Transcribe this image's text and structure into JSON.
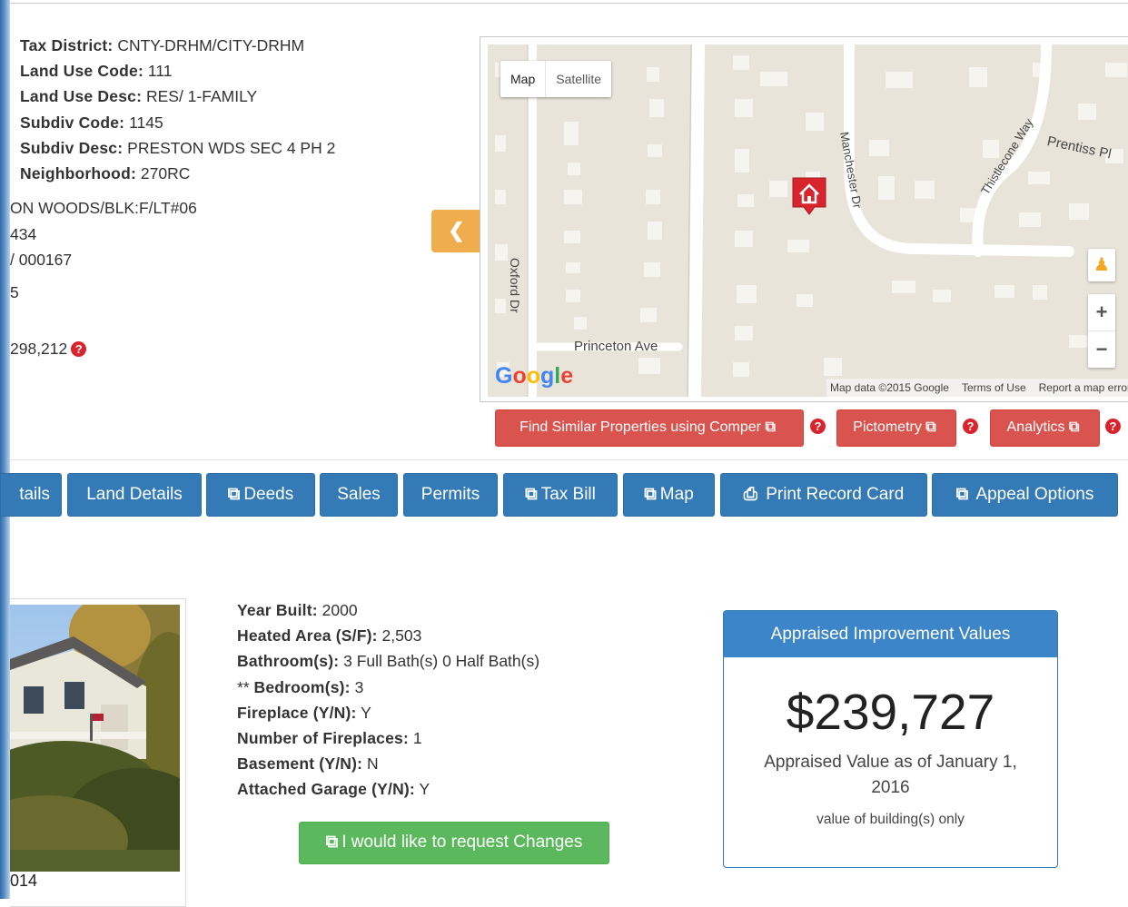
{
  "property_info": [
    {
      "label": "Tax District:",
      "value": "CNTY-DRHM/CITY-DRHM"
    },
    {
      "label": "Land Use Code:",
      "value": "111"
    },
    {
      "label": "Land Use Desc:",
      "value": "RES/ 1-FAMILY"
    },
    {
      "label": "Subdiv Code:",
      "value": "1145"
    },
    {
      "label": "Subdiv Desc:",
      "value": "PRESTON WDS SEC 4 PH 2"
    },
    {
      "label": "Neighborhood:",
      "value": "270RC"
    }
  ],
  "cut_off_values": [
    "ON WOODS/BLK:F/LT#06",
    "434",
    "/ 000167",
    "5",
    "298,212"
  ],
  "collapse_icon": "chevron-left",
  "map": {
    "type_map": "Map",
    "type_satellite": "Satellite",
    "streets": {
      "oxford": "Oxford Dr",
      "princeton": "Princeton Ave",
      "manchester": "Manchester Dr",
      "thistlecone": "Thistlecone Way",
      "prentiss": "Prentiss Pl"
    },
    "zoom_in": "+",
    "zoom_out": "−",
    "pegman_icon": "person-icon",
    "marker_icon": "home-icon",
    "google_letters": [
      "G",
      "o",
      "o",
      "g",
      "l",
      "e"
    ],
    "google_colors": [
      "#4285f4",
      "#ea4335",
      "#fbbc05",
      "#4285f4",
      "#34a853",
      "#ea4335"
    ],
    "map_data": "Map data ©2015 Google",
    "terms": "Terms of Use",
    "report": "Report a map error"
  },
  "action_buttons": {
    "comper": "Find Similar Properties using Comper",
    "pictometry": "Pictometry",
    "analytics": "Analytics"
  },
  "tabs": {
    "building_details": "tails",
    "land_details": "Land Details",
    "deeds": "Deeds",
    "sales": "Sales",
    "permits": "Permits",
    "tax_bill": "Tax Bill",
    "map": "Map",
    "print_record": "Print Record Card",
    "appeal": "Appeal Options"
  },
  "photo_caption": "014",
  "building_info": [
    {
      "label": "Year Built:",
      "value": "2000"
    },
    {
      "label": "Heated Area (S/F):",
      "value": "2,503"
    },
    {
      "label": "Bathroom(s):",
      "value": "3 Full Bath(s) 0 Half Bath(s)"
    },
    {
      "prefix": "** ",
      "label": "Bedroom(s):",
      "value": "3"
    },
    {
      "label": "Fireplace (Y/N):",
      "value": "Y"
    },
    {
      "label": "Number of Fireplaces:",
      "value": "1"
    },
    {
      "label": "Basement (Y/N):",
      "value": "N"
    },
    {
      "label": "Attached Garage (Y/N):",
      "value": "Y"
    }
  ],
  "request_changes": "I would like to request Changes",
  "appraised_panel": {
    "title": "Appraised Improvement Values",
    "value": "$239,727",
    "subtitle": "Appraised Value as of January 1, 2016",
    "note": "value of building(s) only"
  },
  "colors": {
    "primary": "#337ab7",
    "danger": "#d9534f",
    "success": "#5cb85c",
    "warning": "#f0ad4e"
  }
}
